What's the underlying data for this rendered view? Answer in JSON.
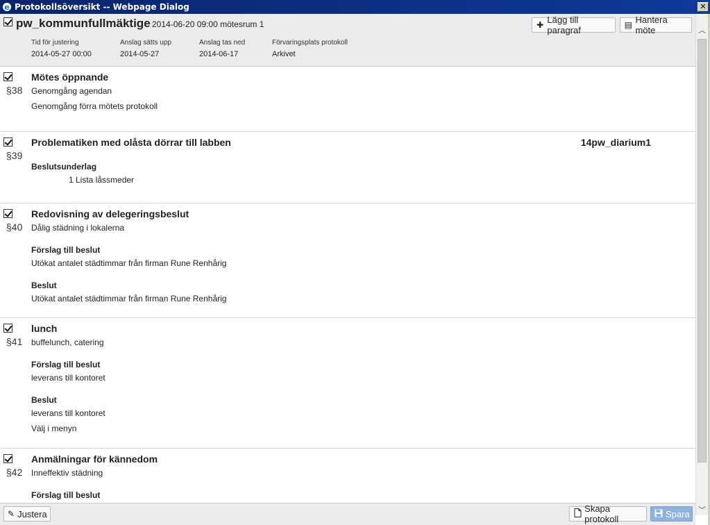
{
  "window": {
    "title": "Protokollsöversikt -- Webpage Dialog"
  },
  "meeting": {
    "name": "pw_kommunfullmäktige",
    "datetime_room": "2014-06-20 09:00 mötesrum 1",
    "fields": [
      {
        "label": "Tid för justering",
        "value": "2014-05-27 00:00"
      },
      {
        "label": "Anslag sätts upp",
        "value": "2014-05-27"
      },
      {
        "label": "Anslag tas ned",
        "value": "2014-06-17"
      },
      {
        "label": "Förvaringsplats protokoll",
        "value": "Arkivet"
      }
    ],
    "buttons": {
      "add_paragraph": "Lägg till paragraf",
      "manage_meeting": "Hantera möte"
    }
  },
  "paragraphs": [
    {
      "number": "§38",
      "title": "Mötes öppnande",
      "lines": [
        "Genomgång agendan",
        "Genomgång förra mötets protokoll"
      ]
    },
    {
      "number": "§39",
      "title": "Problematiken med olåsta dörrar till labben",
      "diary": "14pw_diarium1",
      "section": "Beslutsunderlag",
      "attachment": "1  Lista låssmeder"
    },
    {
      "number": "§40",
      "title": "Redovisning av delegeringsbeslut",
      "description": "Dålig städning i lokalerna",
      "proposal_label": "Förslag till beslut",
      "proposal": "Utökat antalet städtimmar från firman Rune Renhårig",
      "decision_label": "Beslut",
      "decision": "Utökat antalet städtimmar från firman Rune Renhårig"
    },
    {
      "number": "§41",
      "title": "lunch",
      "description": "buffelunch, catering",
      "proposal_label": "Förslag till beslut",
      "proposal": "leverans till kontoret",
      "decision_label": "Beslut",
      "decision": "leverans till kontoret",
      "extra": "Välj i menyn"
    },
    {
      "number": "§42",
      "title": "Anmälningar för kännedom",
      "description": "Inneffektiv städning",
      "proposal_label": "Förslag till beslut"
    }
  ],
  "footer": {
    "adjust": "Justera",
    "create_protocol": "Skapa protokoll",
    "save": "Spara"
  }
}
